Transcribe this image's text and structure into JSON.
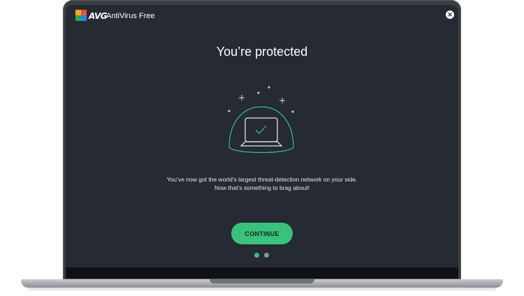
{
  "app": {
    "brand": "AVG",
    "product_name": "AntiVirus Free",
    "close_glyph": "✕",
    "icons": [
      "avg-logo-icon",
      "close-icon",
      "protected-laptop-icon"
    ]
  },
  "main": {
    "title": "You’re protected",
    "message_line1": "You’ve now got the world’s largest threat-detection network on your side.",
    "message_line2": "Now that’s something to brag about!",
    "continue_label": "CONTINUE"
  },
  "pagination": {
    "total": 2,
    "current": 1
  },
  "colors": {
    "background": "#262a33",
    "accent": "#3ac17c",
    "text": "#ffffff"
  }
}
